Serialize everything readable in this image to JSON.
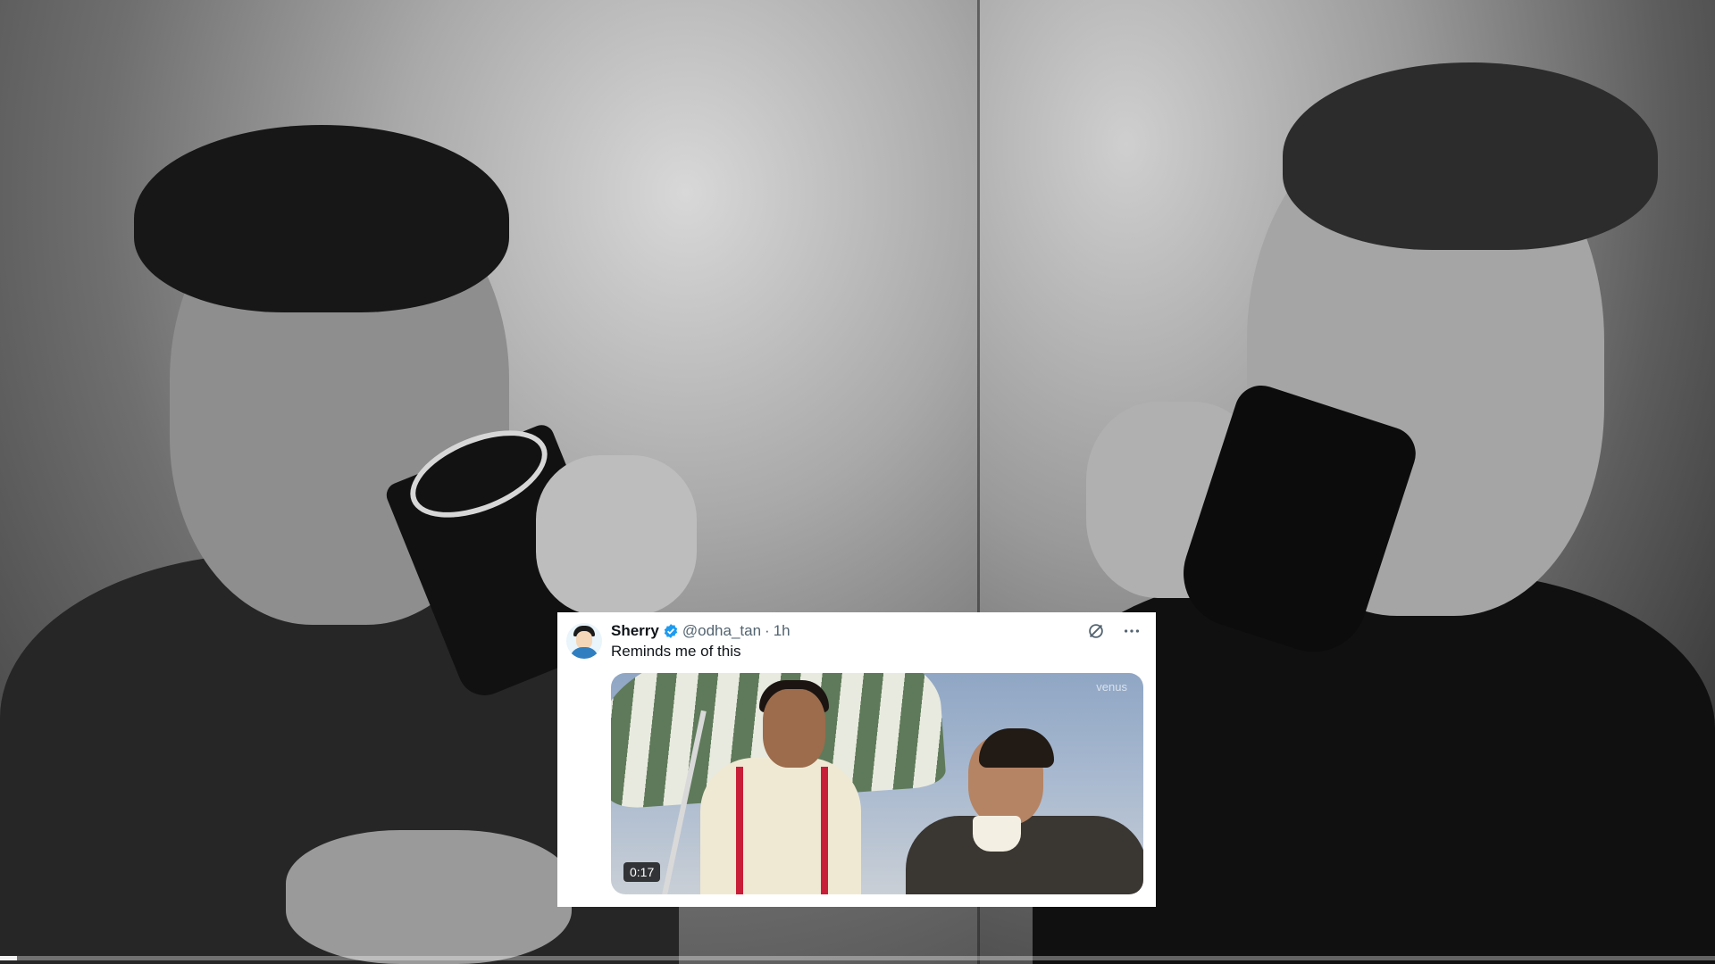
{
  "tweet": {
    "display_name": "Sherry",
    "handle": "@odha_tan",
    "separator": "·",
    "time": "1h",
    "text": "Reminds me of this",
    "media": {
      "duration": "0:17",
      "watermark": "venus"
    }
  },
  "video": {
    "progress_percent": 1
  },
  "colors": {
    "verified": "#1d9bf0",
    "handle_gray": "#536471",
    "suspenders": "#c81e38"
  },
  "icons": [
    "verified-badge-icon",
    "grok-icon",
    "more-icon"
  ]
}
